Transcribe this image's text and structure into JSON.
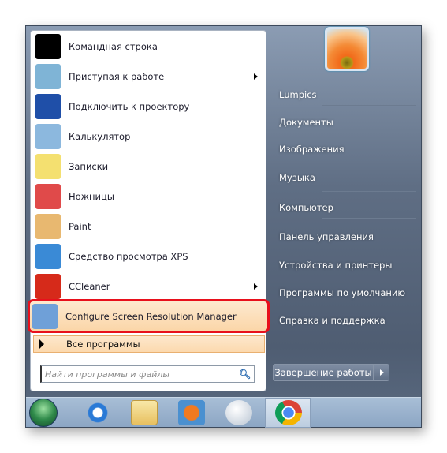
{
  "programs": [
    {
      "label": "Командная строка",
      "icon": "cmd-icon",
      "color": "#000000",
      "submenu": false
    },
    {
      "label": "Приступая к работе",
      "icon": "getting-started-icon",
      "color": "#7fb4d6",
      "submenu": true
    },
    {
      "label": "Подключить к проектору",
      "icon": "projector-icon",
      "color": "#1f4fa8",
      "submenu": false
    },
    {
      "label": "Калькулятор",
      "icon": "calculator-icon",
      "color": "#8cb8de",
      "submenu": false
    },
    {
      "label": "Записки",
      "icon": "sticky-notes-icon",
      "color": "#f4e070",
      "submenu": false
    },
    {
      "label": "Ножницы",
      "icon": "snipping-tool-icon",
      "color": "#e04a4a",
      "submenu": false
    },
    {
      "label": "Paint",
      "icon": "paint-icon",
      "color": "#e8b870",
      "submenu": false
    },
    {
      "label": "Средство просмотра XPS",
      "icon": "xps-viewer-icon",
      "color": "#3a8ad6",
      "submenu": false
    },
    {
      "label": "CCleaner",
      "icon": "ccleaner-icon",
      "color": "#d62a1a",
      "submenu": true
    },
    {
      "label": "Configure Screen Resolution Manager",
      "icon": "screen-resolution-icon",
      "color": "#6fa0d8",
      "submenu": false,
      "highlighted": true
    }
  ],
  "all_programs": "Все программы",
  "search": {
    "placeholder": "Найти программы и файлы"
  },
  "right": [
    "Lumpics",
    "Документы",
    "Изображения",
    "Музыка",
    "Компьютер",
    "Панель управления",
    "Устройства и принтеры",
    "Программы по умолчанию",
    "Справка и поддержка"
  ],
  "shutdown": "Завершение работы",
  "taskbar": [
    "start-orb",
    "internet-explorer-icon",
    "file-explorer-icon",
    "media-player-icon",
    "app-icon",
    "chrome-icon"
  ],
  "colors": {
    "highlight_border": "#e8101c",
    "highlight_bg": "#fbd6a8"
  }
}
